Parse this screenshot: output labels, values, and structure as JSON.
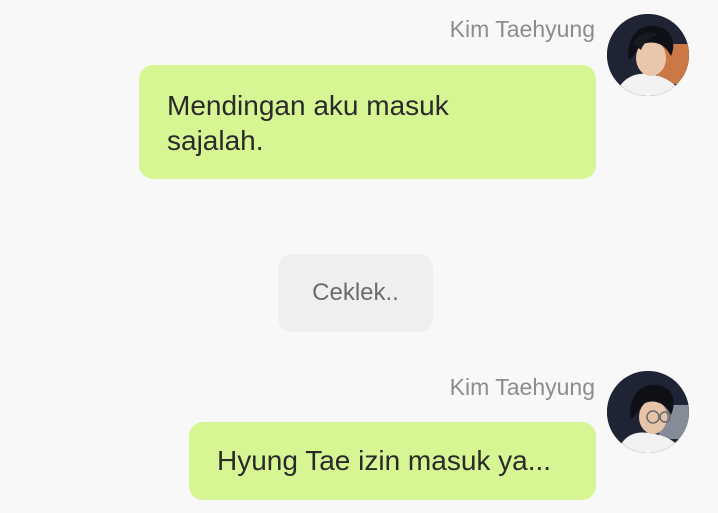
{
  "colors": {
    "background": "#f8f8f8",
    "bubble": "#d6f593",
    "system_bubble": "#efefef",
    "name_text": "#8c8c8c"
  },
  "messages": [
    {
      "sender": "Kim Taehyung",
      "avatar_icon": "profile-photo",
      "text": "Mendingan aku masuk sajalah."
    },
    {
      "system": "Ceklek.."
    },
    {
      "sender": "Kim Taehyung",
      "avatar_icon": "profile-photo",
      "text": "Hyung Tae izin masuk ya..."
    }
  ]
}
